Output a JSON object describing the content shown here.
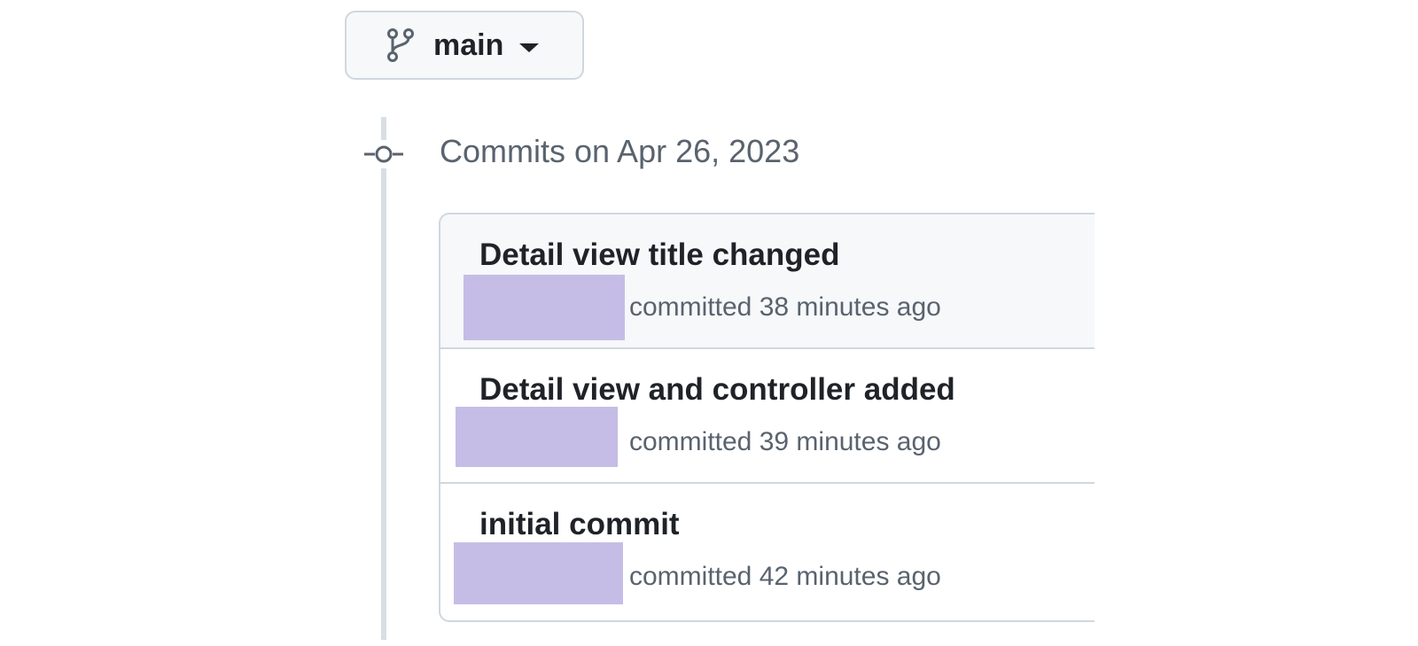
{
  "branch": {
    "name": "main",
    "icon": "git-branch-icon"
  },
  "timeline": {
    "heading": "Commits on Apr 26, 2023",
    "icon": "git-commit-icon"
  },
  "commits": [
    {
      "title": "Detail view title changed",
      "meta": "committed 38 minutes ago"
    },
    {
      "title": "Detail view and controller added",
      "meta": "committed 39 minutes ago"
    },
    {
      "title": "initial commit",
      "meta": "committed 42 minutes ago"
    }
  ],
  "colors": {
    "redaction": "#c5bde6",
    "border": "#d0d7de",
    "muted_text": "#59636e",
    "primary_text": "#1f2328"
  }
}
